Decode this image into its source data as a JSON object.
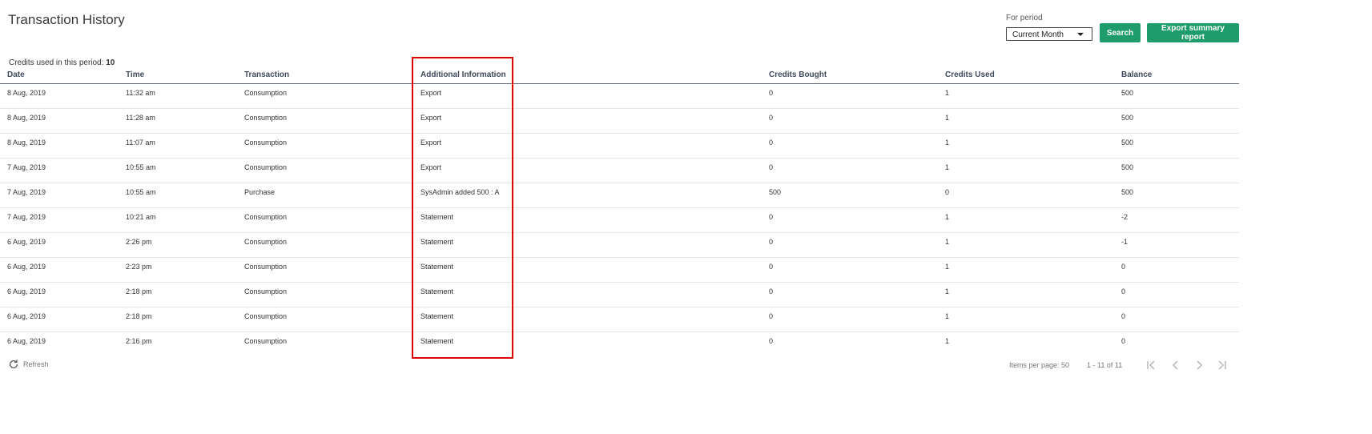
{
  "header": {
    "title": "Transaction History",
    "period_label": "For period",
    "period_value": "Current Month",
    "search_label": "Search",
    "export_label": "Export summary report"
  },
  "summary": {
    "label": "Credits used in this period:",
    "value": "10"
  },
  "table": {
    "columns": [
      "Date",
      "Time",
      "Transaction",
      "Additional Information",
      "Credits Bought",
      "Credits Used",
      "Balance"
    ],
    "rows": [
      [
        "8 Aug, 2019",
        "11:32 am",
        "Consumption",
        "Export",
        "0",
        "1",
        "500"
      ],
      [
        "8 Aug, 2019",
        "11:28 am",
        "Consumption",
        "Export",
        "0",
        "1",
        "500"
      ],
      [
        "8 Aug, 2019",
        "11:07 am",
        "Consumption",
        "Export",
        "0",
        "1",
        "500"
      ],
      [
        "7 Aug, 2019",
        "10:55 am",
        "Consumption",
        "Export",
        "0",
        "1",
        "500"
      ],
      [
        "7 Aug, 2019",
        "10:55 am",
        "Purchase",
        "SysAdmin added 500 : A",
        "500",
        "0",
        "500"
      ],
      [
        "7 Aug, 2019",
        "10:21 am",
        "Consumption",
        "Statement",
        "0",
        "1",
        "-2"
      ],
      [
        "6 Aug, 2019",
        "2:26 pm",
        "Consumption",
        "Statement",
        "0",
        "1",
        "-1"
      ],
      [
        "6 Aug, 2019",
        "2:23 pm",
        "Consumption",
        "Statement",
        "0",
        "1",
        "0"
      ],
      [
        "6 Aug, 2019",
        "2:18 pm",
        "Consumption",
        "Statement",
        "0",
        "1",
        "0"
      ],
      [
        "6 Aug, 2019",
        "2:18 pm",
        "Consumption",
        "Statement",
        "0",
        "1",
        "0"
      ],
      [
        "6 Aug, 2019",
        "2:16 pm",
        "Consumption",
        "Statement",
        "0",
        "1",
        "0"
      ]
    ]
  },
  "footer": {
    "refresh_label": "Refresh",
    "items_per_page": "Items per page: 50",
    "range": "1 - 11 of 11"
  },
  "colors": {
    "accent": "#1f9c6c",
    "highlight": "#e10000",
    "header_rule": "#5f6b7a"
  },
  "icons": {
    "refresh": "refresh-icon",
    "first": "first-page-icon",
    "prev": "previous-page-icon",
    "next": "next-page-icon",
    "last": "last-page-icon",
    "dropdown": "caret-down-icon"
  }
}
